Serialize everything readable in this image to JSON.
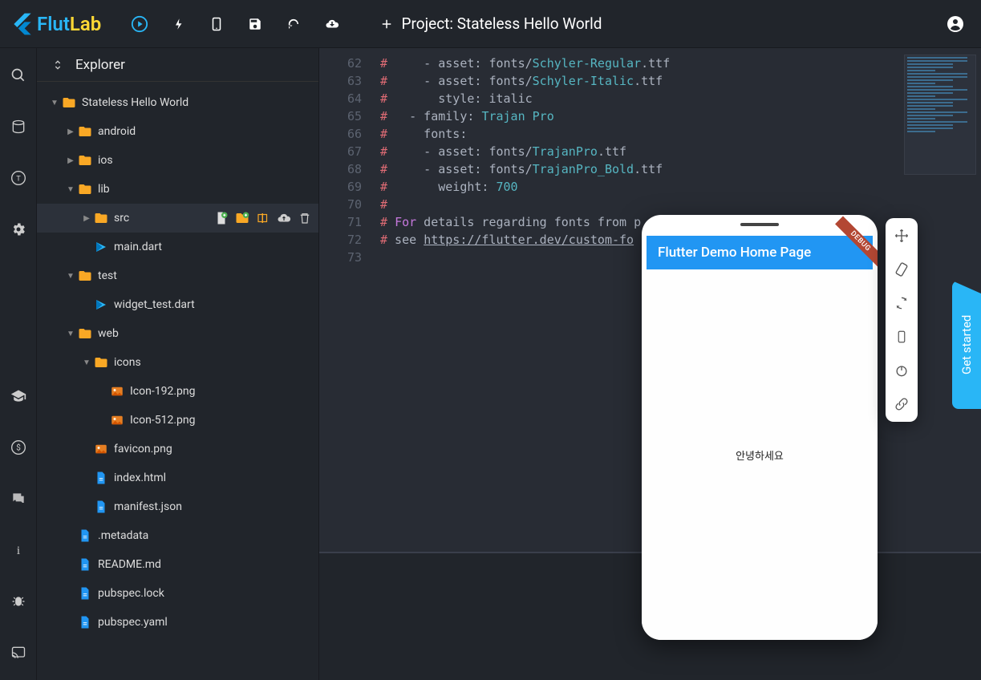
{
  "app": {
    "name_flut": "Flut",
    "name_lab": "Lab",
    "project_prefix": "Project:",
    "project_name": "Stateless Hello World"
  },
  "explorer": {
    "title": "Explorer",
    "tree": [
      {
        "depth": 0,
        "kind": "folder",
        "expanded": true,
        "label": "Stateless Hello World"
      },
      {
        "depth": 1,
        "kind": "folder",
        "expanded": false,
        "label": "android"
      },
      {
        "depth": 1,
        "kind": "folder",
        "expanded": false,
        "label": "ios"
      },
      {
        "depth": 1,
        "kind": "folder",
        "expanded": true,
        "label": "lib"
      },
      {
        "depth": 2,
        "kind": "folder",
        "expanded": false,
        "label": "src",
        "selected": true,
        "actions": true
      },
      {
        "depth": 2,
        "kind": "dart",
        "label": "main.dart"
      },
      {
        "depth": 1,
        "kind": "folder",
        "expanded": true,
        "label": "test"
      },
      {
        "depth": 2,
        "kind": "dart",
        "label": "widget_test.dart"
      },
      {
        "depth": 1,
        "kind": "folder",
        "expanded": true,
        "label": "web"
      },
      {
        "depth": 2,
        "kind": "folder",
        "expanded": true,
        "label": "icons"
      },
      {
        "depth": 3,
        "kind": "image",
        "label": "Icon-192.png"
      },
      {
        "depth": 3,
        "kind": "image",
        "label": "Icon-512.png"
      },
      {
        "depth": 2,
        "kind": "image",
        "label": "favicon.png"
      },
      {
        "depth": 2,
        "kind": "file",
        "label": "index.html"
      },
      {
        "depth": 2,
        "kind": "file",
        "label": "manifest.json"
      },
      {
        "depth": 1,
        "kind": "file",
        "label": ".metadata"
      },
      {
        "depth": 1,
        "kind": "file",
        "label": "README.md"
      },
      {
        "depth": 1,
        "kind": "file",
        "label": "pubspec.lock"
      },
      {
        "depth": 1,
        "kind": "file",
        "label": "pubspec.yaml"
      }
    ]
  },
  "editor": {
    "lines": [
      {
        "num": 62,
        "segments": [
          {
            "cls": "c-comment",
            "t": "#"
          },
          {
            "cls": "c-text",
            "t": "     - asset: fonts/"
          },
          {
            "cls": "c-string",
            "t": "Schyler-Regular"
          },
          {
            "cls": "c-text",
            "t": ".ttf"
          }
        ]
      },
      {
        "num": 63,
        "segments": [
          {
            "cls": "c-comment",
            "t": "#"
          },
          {
            "cls": "c-text",
            "t": "     - asset: fonts/"
          },
          {
            "cls": "c-string",
            "t": "Schyler-Italic"
          },
          {
            "cls": "c-text",
            "t": ".ttf"
          }
        ]
      },
      {
        "num": 64,
        "segments": [
          {
            "cls": "c-comment",
            "t": "#"
          },
          {
            "cls": "c-text",
            "t": "       style: italic"
          }
        ]
      },
      {
        "num": 65,
        "segments": [
          {
            "cls": "c-comment",
            "t": "#"
          },
          {
            "cls": "c-text",
            "t": "   - family: "
          },
          {
            "cls": "c-string",
            "t": "Trajan Pro"
          }
        ]
      },
      {
        "num": 66,
        "segments": [
          {
            "cls": "c-comment",
            "t": "#"
          },
          {
            "cls": "c-text",
            "t": "     fonts:"
          }
        ]
      },
      {
        "num": 67,
        "segments": [
          {
            "cls": "c-comment",
            "t": "#"
          },
          {
            "cls": "c-text",
            "t": "     - asset: fonts/"
          },
          {
            "cls": "c-string",
            "t": "TrajanPro"
          },
          {
            "cls": "c-text",
            "t": ".ttf"
          }
        ]
      },
      {
        "num": 68,
        "segments": [
          {
            "cls": "c-comment",
            "t": "#"
          },
          {
            "cls": "c-text",
            "t": "     - asset: fonts/"
          },
          {
            "cls": "c-string",
            "t": "TrajanPro_Bold"
          },
          {
            "cls": "c-text",
            "t": ".ttf"
          }
        ]
      },
      {
        "num": 69,
        "segments": [
          {
            "cls": "c-comment",
            "t": "#"
          },
          {
            "cls": "c-text",
            "t": "       weight: "
          },
          {
            "cls": "c-string",
            "t": "700"
          }
        ]
      },
      {
        "num": 70,
        "segments": [
          {
            "cls": "c-comment",
            "t": "#"
          }
        ]
      },
      {
        "num": 71,
        "segments": [
          {
            "cls": "c-comment",
            "t": "#"
          },
          {
            "cls": "c-text",
            "t": " "
          },
          {
            "cls": "c-keyword",
            "t": "For"
          },
          {
            "cls": "c-text",
            "t": " details regarding fonts from p"
          }
        ]
      },
      {
        "num": 72,
        "segments": [
          {
            "cls": "c-comment",
            "t": "#"
          },
          {
            "cls": "c-text",
            "t": " see "
          },
          {
            "cls": "c-link",
            "t": "https://flutter.dev/custom-fo"
          }
        ]
      },
      {
        "num": 73,
        "segments": []
      }
    ]
  },
  "emulator": {
    "appbar_title": "Flutter Demo Home Page",
    "debug_label": "DEBUG",
    "body_text": "안녕하세요"
  },
  "get_started": "Get started"
}
